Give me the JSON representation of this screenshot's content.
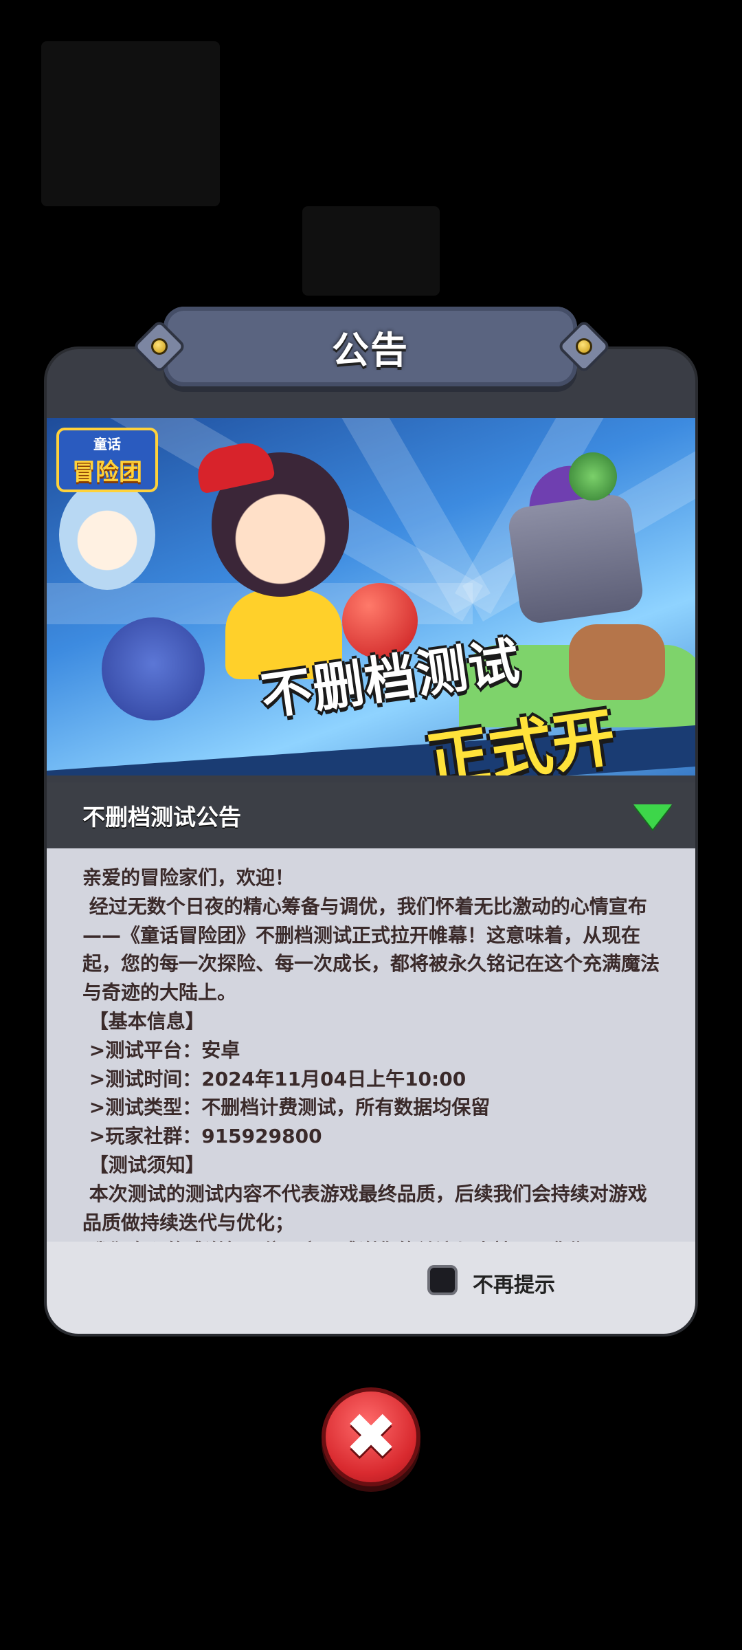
{
  "dialog": {
    "title": "公告",
    "banner": {
      "logo_top": "童话",
      "logo_bottom": "冒险团",
      "headline_1": "不删档测试",
      "headline_2": "正式开启!"
    },
    "section_title": "不删档测试公告",
    "content": "亲爱的冒险家们，欢迎！\n 经过无数个日夜的精心筹备与调优，我们怀着无比激动的心情宣布——《童话冒险团》不删档测试正式拉开帷幕！这意味着，从现在起，您的每一次探险、每一次成长，都将被永久铭记在这个充满魔法与奇迹的大陆上。\n 【基本信息】\n >测试平台：安卓\n >测试时间：2024年11月04日上午10:00\n >测试类型：不删档计费测试，所有数据均保留\n >玩家社群：915929800\n 【测试须知】\n 本次测试的测试内容不代表游戏最终品质，后续我们会持续对游戏品质做持续迭代与优化；\n 我们真心的感谢每一位玩家，感谢您的关注与支持，愿您期",
    "dont_show_label": "不再提示"
  },
  "colors": {
    "dialog_bg": "#3a3d45",
    "content_bg": "#d3d5de",
    "close_red": "#d92a2f",
    "accent_green": "#3dd64a"
  },
  "icons": {
    "close": "close-x-icon",
    "expand": "triangle-down-icon"
  }
}
